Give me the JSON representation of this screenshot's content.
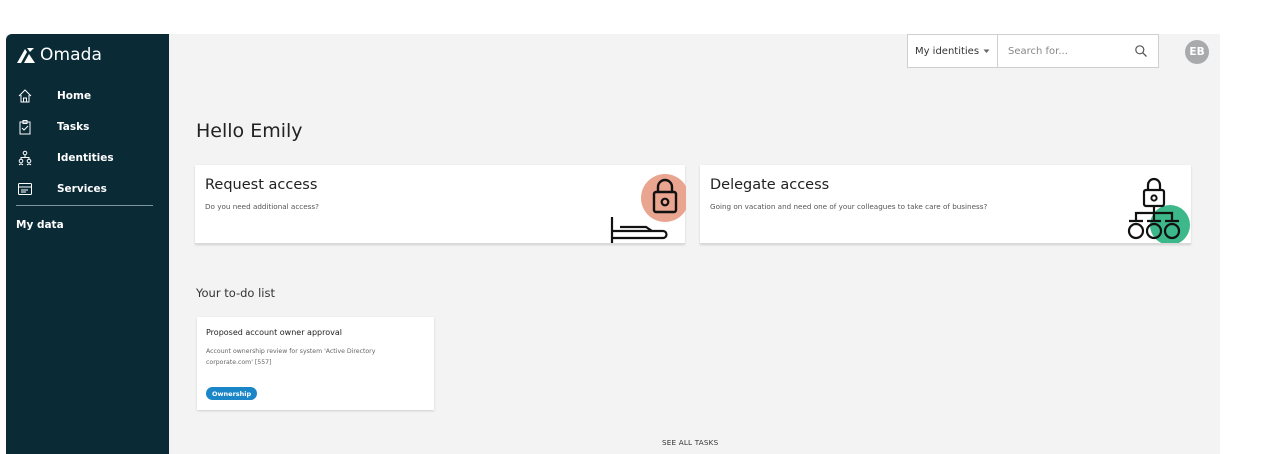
{
  "brand": {
    "name": "Omada"
  },
  "sidebar": {
    "items": [
      {
        "label": "Home",
        "icon": "home-icon"
      },
      {
        "label": "Tasks",
        "icon": "clipboard-icon"
      },
      {
        "label": "Identities",
        "icon": "identities-icon"
      },
      {
        "label": "Services",
        "icon": "services-icon"
      }
    ],
    "my_data": "My data"
  },
  "topbar": {
    "identity_select": "My identities",
    "search_placeholder": "Search for...",
    "avatar_initials": "EB"
  },
  "main": {
    "greeting": "Hello Emily",
    "cards": [
      {
        "title": "Request access",
        "subtitle": "Do you need additional access?",
        "icon": "lock-key-icon"
      },
      {
        "title": "Delegate access",
        "subtitle": "Going on vacation and need one of your colleagues to take care of business?",
        "icon": "org-chart-lock-icon"
      }
    ],
    "todo": {
      "heading": "Your to-do list",
      "tasks": [
        {
          "title": "Proposed account owner approval",
          "description": "Account ownership review for system 'Active Directory corporate.com' [557]",
          "badge": "Ownership"
        }
      ],
      "see_all": "SEE ALL TASKS"
    }
  },
  "colors": {
    "sidebar_bg": "#0a2a36",
    "page_bg": "#f3f3f3",
    "badge": "#1a86c8",
    "request_accent": "#e9a58f",
    "delegate_accent": "#3cb88a",
    "avatar": "#a9aaac"
  }
}
